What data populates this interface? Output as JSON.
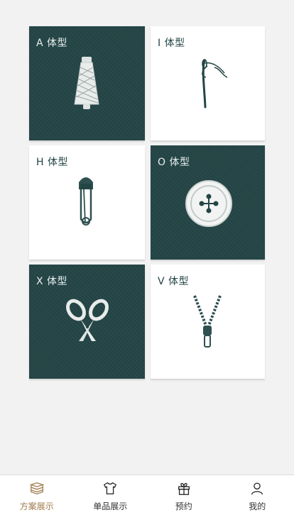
{
  "cards": [
    {
      "label": "A 体型",
      "icon": "thread-spool-icon",
      "theme": "dark"
    },
    {
      "label": "I  体型",
      "icon": "sewing-needle-icon",
      "theme": "light"
    },
    {
      "label": "H 体型",
      "icon": "safety-pin-icon",
      "theme": "light"
    },
    {
      "label": "O 体型",
      "icon": "button-icon",
      "theme": "dark"
    },
    {
      "label": "X 体型",
      "icon": "scissors-icon",
      "theme": "dark"
    },
    {
      "label": "V 体型",
      "icon": "zipper-icon",
      "theme": "light"
    }
  ],
  "tabbar": {
    "items": [
      {
        "label": "方案展示",
        "icon": "layers-icon",
        "active": true
      },
      {
        "label": "单品展示",
        "icon": "tshirt-icon",
        "active": false
      },
      {
        "label": "预约",
        "icon": "gift-icon",
        "active": false
      },
      {
        "label": "我的",
        "icon": "user-icon",
        "active": false
      }
    ]
  },
  "colors": {
    "dark_card": "#244546",
    "accent_active": "#a07a4c",
    "page_bg": "#f2f2f2"
  }
}
